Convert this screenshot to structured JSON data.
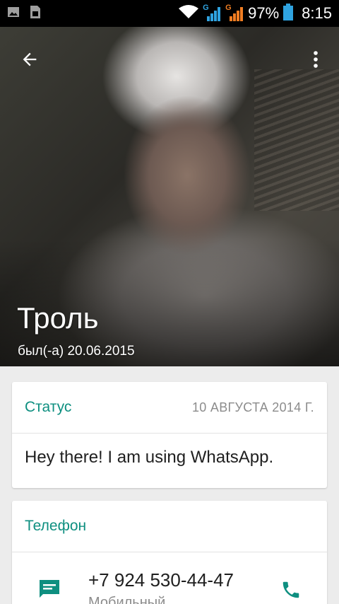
{
  "statusbar": {
    "icons_left": [
      "image-notification-icon",
      "sim-notification-icon"
    ],
    "icons_right": [
      "wifi-icon",
      "signal-1-icon",
      "signal-2-icon",
      "battery-icon"
    ],
    "network_label_1": "G",
    "network_label_2": "G",
    "battery_percent": "97%",
    "time": "8:15",
    "colors": {
      "signal_1": "#2fa3e0",
      "signal_2": "#f07d22",
      "battery": "#2fa3e0"
    }
  },
  "header": {
    "back_icon": "arrow-back-icon",
    "more_icon": "more-vert-icon",
    "contact_name": "Троль",
    "last_seen": "был(-а) 20.06.2015"
  },
  "status_card": {
    "title": "Статус",
    "date": "10 АВГУСТА 2014 Г.",
    "text": "Hey there! I am using WhatsApp."
  },
  "phone_card": {
    "title": "Телефон",
    "number": "+7 924 530-44-47",
    "type": "Мобильный",
    "message_icon": "message-icon",
    "call_icon": "call-icon"
  },
  "colors": {
    "accent": "#0e8f80",
    "background": "#ececec"
  }
}
